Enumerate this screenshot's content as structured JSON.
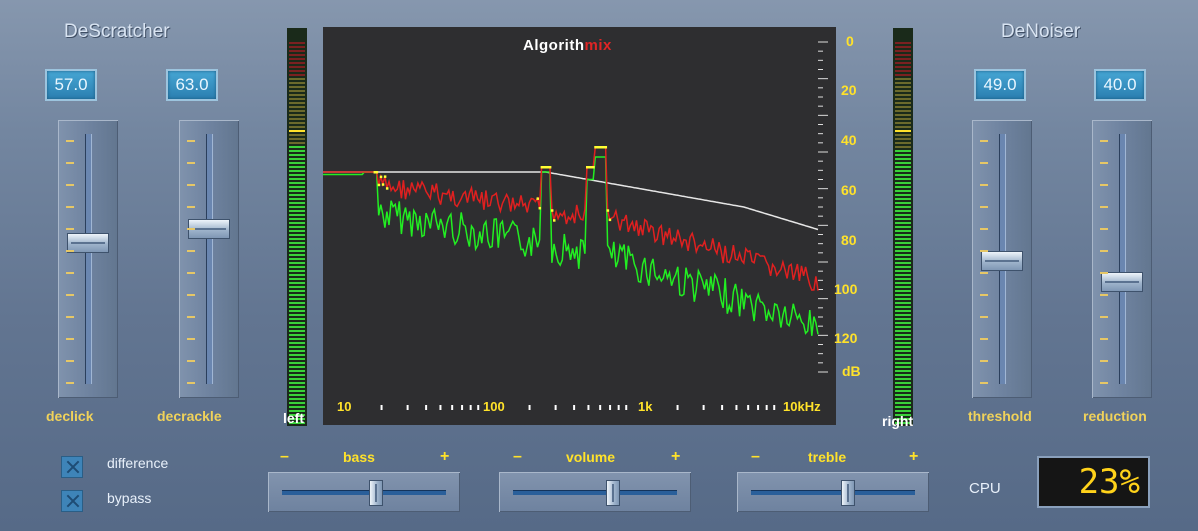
{
  "descratcher": {
    "title": "DeScratcher",
    "declick": {
      "value": "57.0",
      "label": "declick",
      "level": 0.57
    },
    "decrackle": {
      "value": "63.0",
      "label": "decrackle",
      "level": 0.63
    }
  },
  "denoiser": {
    "title": "DeNoiser",
    "threshold": {
      "value": "49.0",
      "label": "threshold",
      "level": 0.49
    },
    "reduction": {
      "value": "40.0",
      "label": "reduction",
      "level": 0.4
    }
  },
  "meters": {
    "left": {
      "label": "left",
      "level": 0.72
    },
    "right": {
      "label": "right",
      "level": 0.71
    }
  },
  "spectrum": {
    "brand_main": "Algorith",
    "brand_accent": "mix",
    "db_labels": [
      "0",
      "20",
      "40",
      "60",
      "80",
      "100",
      "120",
      "dB"
    ],
    "hz_labels": [
      "10",
      "100",
      "1k",
      "10kHz"
    ],
    "colors": {
      "reference": "#e6e6e6",
      "output": "#e02020",
      "input": "#22ee22",
      "peak": "#ffff33"
    }
  },
  "checkboxes": {
    "difference": "difference",
    "bypass": "bypass"
  },
  "eq": {
    "bass": {
      "label": "bass",
      "minus": "–",
      "plus": "+",
      "position": 0.58
    },
    "volume": {
      "label": "volume",
      "minus": "–",
      "plus": "+",
      "position": 0.62
    },
    "treble": {
      "label": "treble",
      "minus": "–",
      "plus": "+",
      "position": 0.6
    }
  },
  "cpu": {
    "label": "CPU",
    "value": "23%"
  }
}
